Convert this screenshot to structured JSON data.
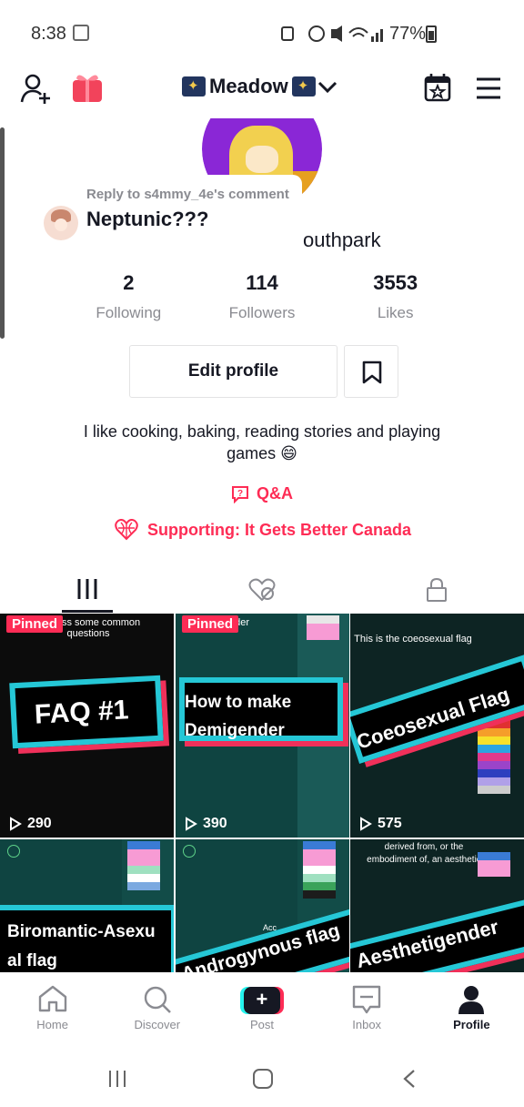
{
  "status_bar": {
    "time": "8:38",
    "battery": "77%"
  },
  "header": {
    "username": "Meadow"
  },
  "reply_overlay": {
    "label": "Reply to s4mmy_4e's comment",
    "text": "Neptunic???"
  },
  "profile": {
    "handle_partial": "outhpark",
    "stats": [
      {
        "value": "2",
        "label": "Following"
      },
      {
        "value": "114",
        "label": "Followers"
      },
      {
        "value": "3553",
        "label": "Likes"
      }
    ],
    "edit_profile_label": "Edit profile",
    "bio": "I like cooking, baking, reading stories and playing games 😄",
    "qa_label": "Q&A",
    "supporting_label": "Supporting: It Gets Better Canada"
  },
  "videos": [
    {
      "pinned": "Pinned",
      "top_text": "address some common questions",
      "title": "FAQ #1",
      "views": "290"
    },
    {
      "pinned": "Pinned",
      "top_text": "nder",
      "title_line1": "How to make",
      "title_line2": "Demigender",
      "views": "390"
    },
    {
      "top_text": "This is the coeosexual flag",
      "title": "Coeosexual Flag",
      "views": "575"
    },
    {
      "title_line1": "Biromantic-Asexu",
      "title_line2": "al flag"
    },
    {
      "title": "Androgynous flag",
      "mid_text": "Acc"
    },
    {
      "top_text": "derived from, or the embodiment of, an aesthetic",
      "title": "Aesthetigender"
    }
  ],
  "bottom_nav": [
    {
      "label": "Home"
    },
    {
      "label": "Discover"
    },
    {
      "label": "Post"
    },
    {
      "label": "Inbox"
    },
    {
      "label": "Profile"
    }
  ],
  "colors": {
    "accent": "#fe2c55",
    "cyan": "#25f4ee",
    "text": "#161823",
    "muted": "#8a8b91"
  }
}
